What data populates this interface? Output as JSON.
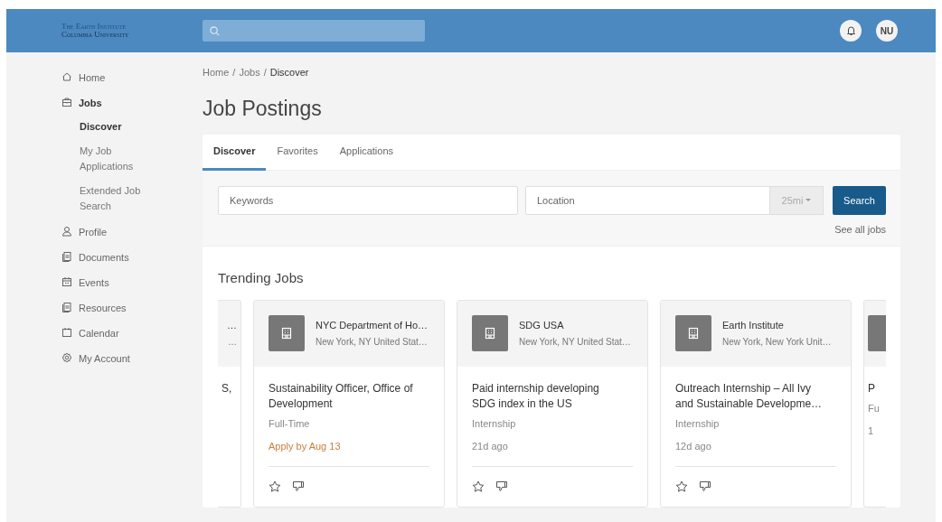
{
  "header": {
    "logo": [
      "The Earth Institute",
      "Columbia University"
    ],
    "avatar": "NU"
  },
  "sidebar": {
    "items": [
      {
        "label": "Home",
        "selected": false
      },
      {
        "label": "Jobs",
        "selected": true,
        "expanded": true,
        "children": [
          {
            "label": "Discover",
            "selected": true
          },
          {
            "label": "My Job Applications",
            "selected": false
          },
          {
            "label": "Extended Job Search",
            "selected": false
          }
        ]
      },
      {
        "label": "Profile",
        "selected": false
      },
      {
        "label": "Documents",
        "selected": false
      },
      {
        "label": "Events",
        "selected": false
      },
      {
        "label": "Resources",
        "selected": false
      },
      {
        "label": "Calendar",
        "selected": false
      },
      {
        "label": "My Account",
        "selected": false
      }
    ]
  },
  "breadcrumb": [
    "Home",
    "Jobs",
    "Discover"
  ],
  "breadcrumb_separator": "/",
  "page_title": "Job Postings",
  "tabs": [
    {
      "label": "Discover",
      "selected": true
    },
    {
      "label": "Favorites",
      "selected": false
    },
    {
      "label": "Applications",
      "selected": false
    }
  ],
  "search": {
    "keywords_placeholder": "Keywords",
    "location_placeholder": "Location",
    "radius": "25mi",
    "button": "Search",
    "see_all": "See all jobs"
  },
  "trending": {
    "title": "Trending Jobs",
    "cards": [
      {
        "kind": "partial-left",
        "company": "…",
        "location": "…",
        "title": "S,"
      },
      {
        "kind": "full",
        "company": "NYC Department of Ho…",
        "location": "New York, NY United Stat…",
        "title": "Sustainability Officer, Office of Development",
        "job_type": "Full-Time",
        "note": {
          "kind": "deadline",
          "text": "Apply by Aug 13"
        }
      },
      {
        "kind": "full",
        "company": "SDG USA",
        "location": "New York, NY United Stat…",
        "title": "Paid internship developing SDG index in the US",
        "job_type": "Internship",
        "note": {
          "kind": "posted",
          "text": "21d ago"
        }
      },
      {
        "kind": "full",
        "company": "Earth Institute",
        "location": "New York, New York Unit…",
        "title": "Outreach Internship – All Ivy and Sustainable Developme…",
        "job_type": "Internship",
        "note": {
          "kind": "posted",
          "text": "12d ago"
        }
      },
      {
        "kind": "partial-right",
        "title": "P",
        "job_type": "Fu",
        "note": {
          "kind": "posted",
          "text": "1"
        }
      }
    ]
  }
}
